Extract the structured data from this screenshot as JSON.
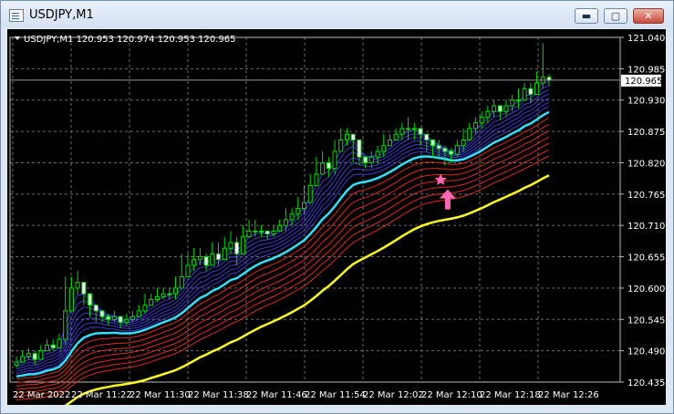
{
  "window": {
    "title": "USDJPY,M1"
  },
  "buttons": {
    "minimize": "▬",
    "maximize": "▢",
    "close": "✕"
  },
  "chart_header": "USDJPY,M1  120.953 120.974 120.953 120.965",
  "current_price_label": "120.965",
  "colors": {
    "background": "#000000",
    "grid": "#6e6e6e",
    "candle": "#00e000",
    "fast_ema": "#3b3bd8",
    "mid_ema": "#33e0ff",
    "slow_ema": "#dc2d18",
    "slowest_ema": "#ffff22",
    "signal": "#ff69b4",
    "text": "#ffffff"
  },
  "chart_data": {
    "type": "candlestick",
    "symbol": "USDJPY",
    "timeframe": "M1",
    "ylim": [
      120.435,
      121.04
    ],
    "y_ticks": [
      "121.040",
      "120.985",
      "120.930",
      "120.875",
      "120.820",
      "120.765",
      "120.710",
      "120.655",
      "120.600",
      "120.545",
      "120.490",
      "120.435"
    ],
    "x_ticks": [
      "22 Mar 2022",
      "22 Mar 11:22",
      "22 Mar 11:30",
      "22 Mar 11:38",
      "22 Mar 11:46",
      "22 Mar 11:54",
      "22 Mar 12:02",
      "22 Mar 12:10",
      "22 Mar 12:18",
      "22 Mar 12:26"
    ],
    "last_price": 120.965,
    "close": [
      120.47,
      120.48,
      120.485,
      120.475,
      120.49,
      120.5,
      120.495,
      120.51,
      120.56,
      120.6,
      120.61,
      120.59,
      120.57,
      120.56,
      120.55,
      120.545,
      120.55,
      120.54,
      120.545,
      120.55,
      120.56,
      120.57,
      120.58,
      120.585,
      120.59,
      120.59,
      120.6,
      120.62,
      120.64,
      120.65,
      120.655,
      120.64,
      120.66,
      120.65,
      120.67,
      120.68,
      120.66,
      120.69,
      120.7,
      120.7,
      120.7,
      120.695,
      120.7,
      120.71,
      120.72,
      120.73,
      120.74,
      120.75,
      120.78,
      120.8,
      120.82,
      120.81,
      120.84,
      120.86,
      120.87,
      120.86,
      120.83,
      120.82,
      120.83,
      120.84,
      120.85,
      120.86,
      120.87,
      120.88,
      120.88,
      120.88,
      120.87,
      120.86,
      120.85,
      120.845,
      120.84,
      120.835,
      120.85,
      120.86,
      120.88,
      120.89,
      120.9,
      120.91,
      120.92,
      120.91,
      120.92,
      120.93,
      120.93,
      120.95,
      120.94,
      120.96,
      120.97,
      120.965
    ],
    "high": [
      120.48,
      120.49,
      120.495,
      120.49,
      120.5,
      120.51,
      120.51,
      120.52,
      120.62,
      120.62,
      120.63,
      120.61,
      120.59,
      120.57,
      120.56,
      120.555,
      120.56,
      120.55,
      120.555,
      120.56,
      120.57,
      120.59,
      120.59,
      120.6,
      120.6,
      120.6,
      120.62,
      120.66,
      120.66,
      120.67,
      120.67,
      120.66,
      120.68,
      120.68,
      120.69,
      120.7,
      120.69,
      120.71,
      120.72,
      120.72,
      120.71,
      120.7,
      120.71,
      120.72,
      120.74,
      120.74,
      120.76,
      120.78,
      120.8,
      120.83,
      120.84,
      120.83,
      120.86,
      120.88,
      120.88,
      120.87,
      120.85,
      120.83,
      120.84,
      120.85,
      120.87,
      120.87,
      120.88,
      120.89,
      120.9,
      120.89,
      120.88,
      120.87,
      120.86,
      120.86,
      120.85,
      120.845,
      120.86,
      120.88,
      120.89,
      120.9,
      120.91,
      120.92,
      120.93,
      120.92,
      120.93,
      120.94,
      120.95,
      120.96,
      120.96,
      120.98,
      121.03,
      120.975
    ],
    "low": [
      120.46,
      120.47,
      120.475,
      120.465,
      120.48,
      120.49,
      120.49,
      120.5,
      120.5,
      120.58,
      120.59,
      120.57,
      120.55,
      120.54,
      120.54,
      120.535,
      120.54,
      120.53,
      120.535,
      120.54,
      120.55,
      120.555,
      120.57,
      120.575,
      120.58,
      120.58,
      120.58,
      120.6,
      120.62,
      120.63,
      120.64,
      120.63,
      120.64,
      120.64,
      120.65,
      120.66,
      120.64,
      120.67,
      120.69,
      120.69,
      120.69,
      120.685,
      120.69,
      120.7,
      120.7,
      120.71,
      120.72,
      120.73,
      120.75,
      120.78,
      120.8,
      120.795,
      120.8,
      120.84,
      120.85,
      120.82,
      120.815,
      120.81,
      120.81,
      120.82,
      120.83,
      120.85,
      120.86,
      120.86,
      120.86,
      120.86,
      120.85,
      120.84,
      120.83,
      120.825,
      120.815,
      120.82,
      120.83,
      120.84,
      120.86,
      120.87,
      120.88,
      120.89,
      120.9,
      120.895,
      120.9,
      120.91,
      120.915,
      120.93,
      120.925,
      120.94,
      120.95,
      120.955
    ],
    "signal_arrow_index": 70,
    "signal_star_index": 69
  }
}
